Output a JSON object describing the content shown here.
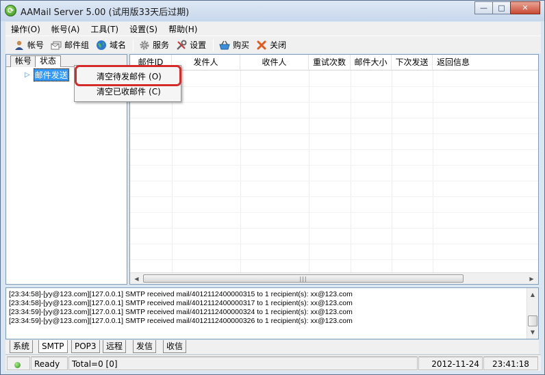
{
  "window": {
    "title": "AAMail Server 5.00 (试用版33天后过期)",
    "minimize_glyph": "—",
    "maximize_glyph": "□",
    "close_glyph": "✕"
  },
  "menu": [
    "操作(O)",
    "帐号(A)",
    "工具(T)",
    "设置(S)",
    "帮助(H)"
  ],
  "toolbar": {
    "account": "帐号",
    "mail_group": "邮件组",
    "domain": "域名",
    "service": "服务",
    "settings": "设置",
    "buy": "购买",
    "close": "关闭"
  },
  "left_tabs": [
    "帐号",
    "状态"
  ],
  "tree": {
    "node": "邮件发送"
  },
  "grid": {
    "columns": [
      "邮件ID",
      "发件人",
      "收件人",
      "重试次数",
      "邮件大小",
      "下次发送",
      "返回信息"
    ]
  },
  "context_menu": [
    {
      "label": "清空待发邮件",
      "key": "(O)"
    },
    {
      "label": "清空已收邮件",
      "key": "(C)"
    }
  ],
  "log": [
    "[23:34:58]-[yy@123.com][127.0.0.1] SMTP received mail/4012112400000315 to 1 recipient(s): xx@123.com",
    "[23:34:58]-[yy@123.com][127.0.0.1] SMTP received mail/4012112400000317 to 1 recipient(s): xx@123.com",
    "[23:34:59]-[yy@123.com][127.0.0.1] SMTP received mail/4012112400000324 to 1 recipient(s): xx@123.com",
    "[23:34:59]-[yy@123.com][127.0.0.1] SMTP received mail/4012112400000326 to 1 recipient(s): xx@123.com"
  ],
  "bottom_tabs": [
    "系统",
    "SMTP",
    "POP3",
    "远程",
    "发信",
    "收信"
  ],
  "status": {
    "ready": "Ready",
    "total": "Total=0 [0]",
    "date": "2012-11-24",
    "time": "23:41:18"
  },
  "colors": {
    "highlight_box": "#d42a2a",
    "selection": "#3399ff"
  }
}
